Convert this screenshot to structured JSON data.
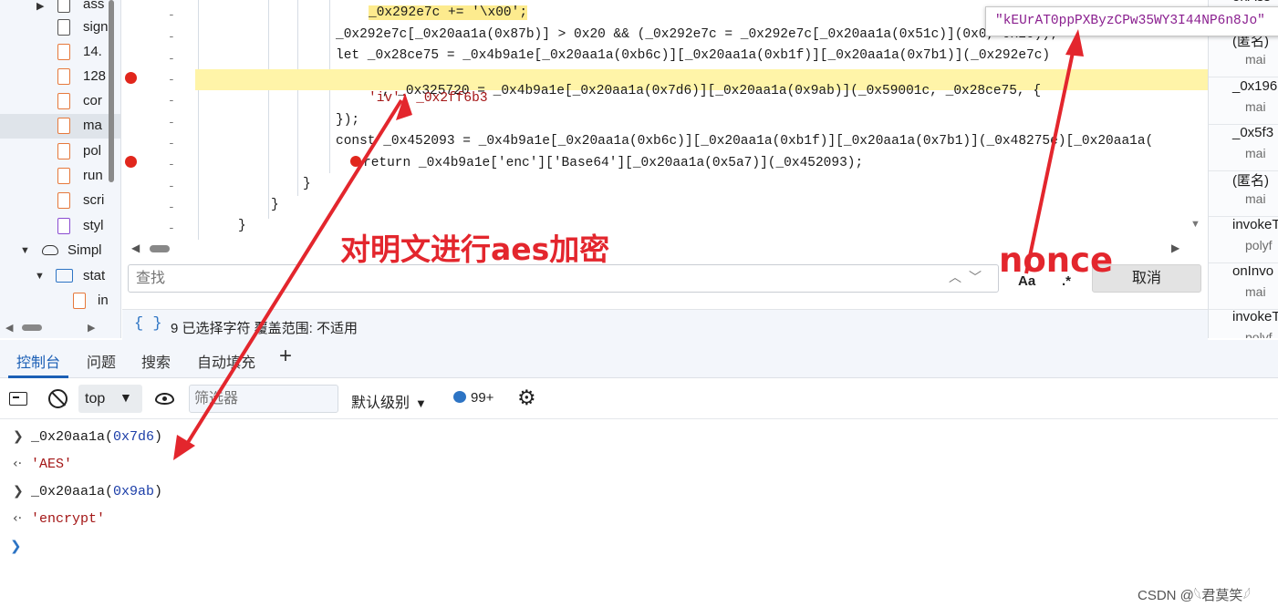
{
  "file_tree": {
    "items": [
      {
        "label": "ass",
        "icon": "file-icon",
        "color": "gray"
      },
      {
        "label": "sign",
        "icon": "file-icon",
        "color": "gray"
      },
      {
        "label": "14.",
        "icon": "file-icon",
        "color": "orange"
      },
      {
        "label": "128",
        "icon": "file-icon",
        "color": "orange"
      },
      {
        "label": "cor",
        "icon": "file-icon",
        "color": "orange"
      },
      {
        "label": "ma",
        "icon": "file-icon",
        "color": "orange",
        "selected": true
      },
      {
        "label": "pol",
        "icon": "file-icon",
        "color": "orange"
      },
      {
        "label": "run",
        "icon": "file-icon",
        "color": "orange"
      },
      {
        "label": "scri",
        "icon": "file-icon",
        "color": "orange"
      },
      {
        "label": "styl",
        "icon": "file-icon",
        "color": "purple"
      },
      {
        "label": "Simpl",
        "icon": "cloud-icon"
      },
      {
        "label": "stat",
        "icon": "folder-icon"
      },
      {
        "label": "in",
        "icon": "file-icon",
        "color": "orange"
      }
    ]
  },
  "editor": {
    "lines": {
      "l1_tail": "_0x292e7c += '\\x00';",
      "l2": "_0x292e7c[_0x20aa1a(0x87b)] > 0x20 && (_0x292e7c = _0x292e7c[_0x20aa1a(0x51c)](0x0, 0x20));",
      "l3": "let _0x28ce75 = _0x4b9a1e[_0x20aa1a(0xb6c)][_0x20aa1a(0xb1f)][_0x20aa1a(0x7b1)](_0x292e7c)",
      "l4": ", _0x325720 = _0x4b9a1e[_0x20aa1a(0x7d6)][_0x20aa1a(0x9ab)](_0x59001c, _0x28ce75, {",
      "l5": "'iv': _0x2ff6b3",
      "l6": "});",
      "l7": "const _0x452093 = _0x4b9a1e[_0x20aa1a(0xb6c)][_0x20aa1a(0xb1f)][_0x20aa1a(0x7b1)](_0x48275e)[_0x20aa1a(",
      "l8": "return _0x4b9a1e['enc']['Base64'][_0x20aa1a(0x5a7)](_0x452093);",
      "l9": "}",
      "l10": "}",
      "l11": "}"
    }
  },
  "tooltip": {
    "value": "\"kEUrAT0ppPXByzCPw35WY3I44NP6n8Jo\""
  },
  "find_bar": {
    "placeholder": "查找",
    "case_label": "Aa",
    "regex_label": ".*",
    "cancel_label": "取消"
  },
  "status_bar": {
    "braces": "{ }",
    "text": "9 已选择字符   覆盖范围: 不适用"
  },
  "call_stack": {
    "items": [
      {
        "name": "onAss",
        "file": ""
      },
      {
        "name": "(匿名)",
        "file": "mai"
      },
      {
        "name": "_0x196",
        "file": "mai"
      },
      {
        "name": "_0x5f3",
        "file": "mai"
      },
      {
        "name": "(匿名)",
        "file": "mai"
      },
      {
        "name": "invokeT",
        "file": "polyf"
      },
      {
        "name": "onInvo",
        "file": "mai"
      },
      {
        "name": "invokeT",
        "file": "polyf"
      }
    ]
  },
  "console_tabs": [
    "控制台",
    "问题",
    "搜索",
    "自动填充"
  ],
  "console_toolbar": {
    "context": "top",
    "filter_placeholder": "筛选器",
    "level": "默认级别",
    "issues_count": "99+"
  },
  "console": {
    "entries": [
      {
        "type": "input",
        "text_prefix": "_0x20aa1a(",
        "text_hex": "0x7d6",
        "text_suffix": ")"
      },
      {
        "type": "result",
        "text": "'AES'"
      },
      {
        "type": "input",
        "text_prefix": "_0x20aa1a(",
        "text_hex": "0x9ab",
        "text_suffix": ")"
      },
      {
        "type": "result",
        "text": "'encrypt'"
      }
    ]
  },
  "annotations": {
    "aes_label": "对明文进行aes加密",
    "nonce_label": "nonce",
    "color": "#e3262d"
  },
  "watermark": "CSDN @𓆩君莫笑𓆪"
}
